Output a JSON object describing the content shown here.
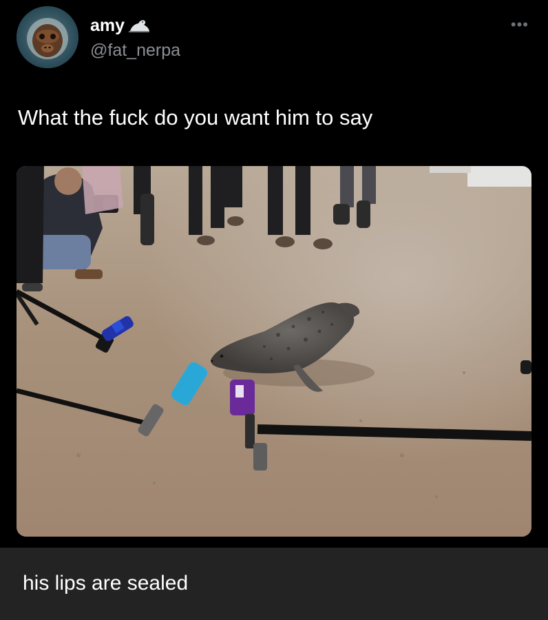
{
  "user": {
    "display_name": "amy",
    "handle": "@fat_nerpa",
    "name_emoji": "seal-icon",
    "avatar": "monkey-face-avatar"
  },
  "tweet": {
    "text": "What the fuck do you want him to say",
    "more_icon": "more-options-icon",
    "media": "photo of a seal on wet sand surrounded by reporters holding microphones and a photographer"
  },
  "caption": {
    "text": "his lips are sealed"
  },
  "colors": {
    "background": "#000000",
    "caption_bar": "#232323",
    "handle": "#8b8f93",
    "text": "#ffffff"
  }
}
